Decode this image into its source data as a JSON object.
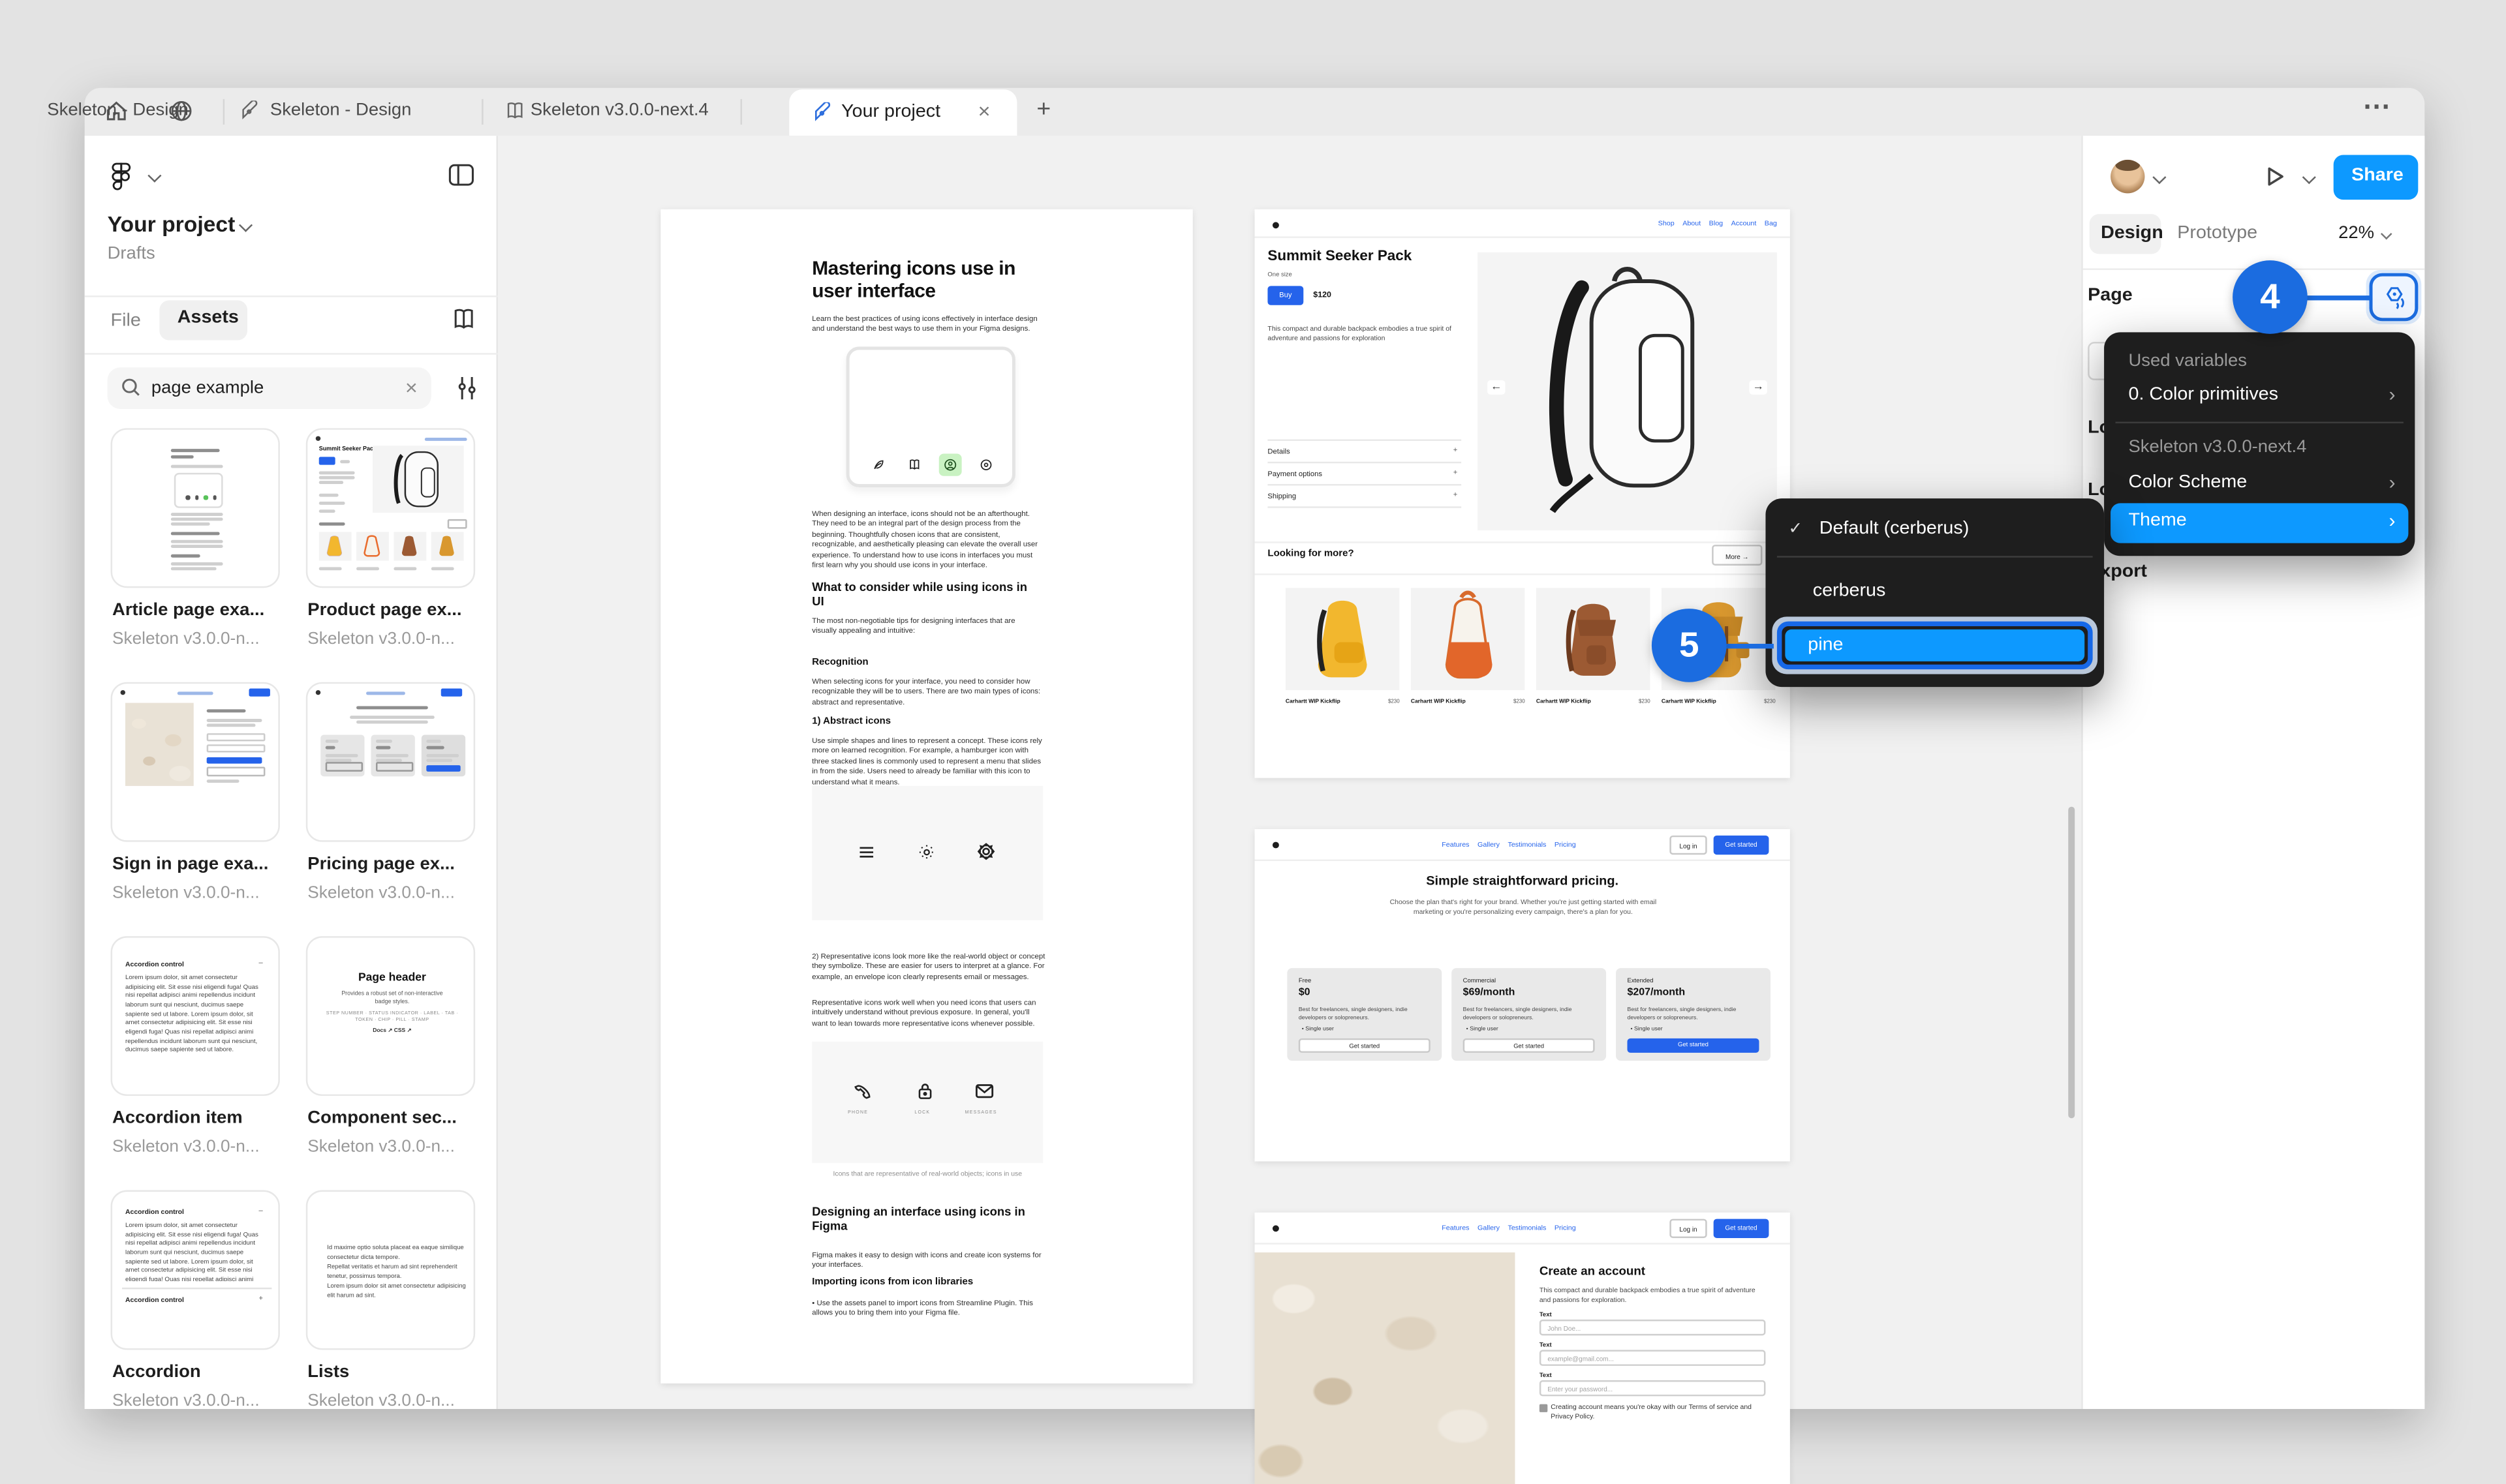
{
  "window": {
    "more_actions_glyph": "⋯",
    "new_tab_glyph": "+",
    "close_glyph": "×"
  },
  "tabs": {
    "tab1": {
      "label": "Skeleton - Design"
    },
    "tab2": {
      "label": "Skeleton v3.0.0-next.4"
    },
    "tab3": {
      "label": "Your project"
    }
  },
  "sidebar": {
    "project_title": "Your project",
    "project_subtitle": "Drafts",
    "tab_file": "File",
    "tab_assets": "Assets",
    "search": {
      "value": "page example",
      "clear_glyph": "×"
    },
    "assets": {
      "items": [
        {
          "title": "Article page exa...",
          "library": "Skeleton v3.0.0-n..."
        },
        {
          "title": "Product page ex...",
          "library": "Skeleton v3.0.0-n..."
        },
        {
          "title": "Sign in page exa...",
          "library": "Skeleton v3.0.0-n..."
        },
        {
          "title": "Pricing page ex...",
          "library": "Skeleton v3.0.0-n..."
        },
        {
          "title": "Accordion item",
          "library": "Skeleton v3.0.0-n..."
        },
        {
          "title": "Component sec...",
          "library": "Skeleton v3.0.0-n..."
        },
        {
          "title": "Accordion",
          "library": "Skeleton v3.0.0-n..."
        },
        {
          "title": "Lists",
          "library": "Skeleton v3.0.0-n..."
        }
      ],
      "thumbs": {
        "accordion_title": "Accordion control",
        "accordion_body": "Lorem ipsum dolor, sit amet consectetur adipisicing elit. Sit esse nisi eligendi fuga! Quas nisi repellat adipisci animi repellendus incidunt laborum sunt qui nesciunt, ducimus saepe sapiente sed ut labore. Lorem ipsum dolor, sit amet consectetur adipisicing elit. Sit esse nisi eligendi fuga! Quas nisi repellat adipisci animi repellendus incidunt laborum sunt qui nesciunt, ducimus saepe sapiente sed ut labore.",
        "accordion_plus": "+",
        "accordion_minus": "–",
        "component_title": "Page header",
        "component_sub": "Provides a robust set of non-interactive badge styles.",
        "component_badges": "STEP NUMBER · STATUS INDICATOR · LABEL · TAB · TOKEN · CHIP · PILL · STAMP",
        "component_links": "Docs ↗    CSS ↗",
        "product_title": "Summit Seeker Pack",
        "lists_li1": "Id maxime optio soluta placeat ea eaque similique consectetur dicta tempore.",
        "lists_li2": "Repellat veritatis et harum ad sint reprehenderit tenetur, possimus tempora.",
        "lists_li3": "Lorem ipsum dolor sit amet consectetur adipisicing elit harum ad sint."
      }
    }
  },
  "canvas": {
    "article": {
      "title": "Mastering icons use in user interface",
      "intro": "Learn the best practices of using icons effectively in interface design and understand the best ways to use them in your Figma designs.",
      "p1": "When designing an interface, icons should not be an afterthought. They need to be an integral part of the design process from the beginning. Thoughtfully chosen icons that are consistent, recognizable, and aesthetically pleasing can elevate the overall user experience. To understand how to use icons in interfaces you must first learn why you should use icons in your interface.",
      "h2_consider": "What to consider while using icons in UI",
      "consider_sub": "The most non-negotiable tips for designing interfaces that are visually appealing and intuitive:",
      "h3_recognition": "Recognition",
      "recognition_p": "When selecting icons for your interface, you need to consider how recognizable they will be to users. There are two main types of icons: abstract and representative.",
      "h3_abstract": "1) Abstract icons",
      "abstract_p": "Use simple shapes and lines to represent a concept. These icons rely more on learned recognition. For example, a hamburger icon with three stacked lines is commonly used to represent a menu that slides in from the side. Users need to already be familiar with this icon to understand what it means.",
      "representative_p1": "2) Representative icons look more like the real-world object or concept they symbolize. These are easier for users to interpret at a glance. For example, an envelope icon clearly represents email or messages.",
      "representative_p2": "Representative icons work well when you need icons that users can intuitively understand without previous exposure. In general, you'll want to lean towards more representative icons whenever possible.",
      "icon_label_phone": "PHONE",
      "icon_label_lock": "LOCK",
      "icon_label_messages": "MESSAGES",
      "caption": "Icons that are representative of real-world objects; icons in use",
      "h2_designing": "Designing an interface using icons in Figma",
      "designing_p": "Figma makes it easy to design with icons and create icon systems for your interfaces.",
      "h3_importing": "Importing icons from icon libraries",
      "importing_li": "•  Use the assets panel to import icons from Streamline Plugin. This allows you to bring them into your Figma file."
    },
    "product": {
      "nav": [
        "Shop",
        "About",
        "Blog",
        "Account",
        "Bag"
      ],
      "title": "Summit Seeker Pack",
      "size_label": "One size",
      "buy_label": "Buy",
      "price": "$120",
      "description": "This compact and durable backpack embodies a true spirit of adventure and passions for exploration",
      "accordion1": "Details",
      "accordion2": "Payment options",
      "accordion3": "Shipping",
      "accordion_plus": "+",
      "more_heading": "Looking for more?",
      "more_button": "More  →",
      "prev_glyph": "←",
      "next_glyph": "→",
      "items": [
        {
          "name": "Carhartt WIP Kickflip",
          "price": "$230"
        },
        {
          "name": "Carhartt WIP Kickflip",
          "price": "$230"
        },
        {
          "name": "Carhartt WIP Kickflip",
          "price": "$230"
        },
        {
          "name": "Carhartt WIP Kickflip",
          "price": "$230"
        }
      ]
    },
    "pricing": {
      "nav": [
        "Features",
        "Gallery",
        "Testimonials",
        "Pricing"
      ],
      "login_label": "Log in",
      "cta_label": "Get started",
      "title": "Simple straightforward pricing.",
      "subtitle": "Choose the plan that's right for your brand. Whether you're just getting started with email marketing or you're personalizing every campaign, there's a plan for you.",
      "plans": [
        {
          "tier": "Free",
          "price": "$0",
          "desc": "Best for freelancers, single designers, indie developers or solopreneurs.",
          "feature": "•  Single user",
          "cta": "Get started"
        },
        {
          "tier": "Commercial",
          "price": "$69/month",
          "desc": "Best for freelancers, single designers, indie developers or solopreneurs.",
          "feature": "•  Single user",
          "cta": "Get started"
        },
        {
          "tier": "Extended",
          "price": "$207/month",
          "desc": "Best for freelancers, single designers, indie developers or solopreneurs.",
          "feature": "•  Single user",
          "cta": "Get started"
        }
      ]
    },
    "signup": {
      "nav": [
        "Features",
        "Gallery",
        "Testimonials",
        "Pricing"
      ],
      "login_label": "Log in",
      "cta_label": "Get started",
      "title": "Create an account",
      "description": "This compact and durable backpack embodies a true spirit of adventure and passions for exploration.",
      "field1_label": "Text",
      "field1_placeholder": "John Doe...",
      "field2_label": "Text",
      "field2_placeholder": "example@gmail.com...",
      "field3_label": "Text",
      "field3_placeholder": "Enter your password...",
      "terms": "Creating account means you're okay with our Terms of service and Privacy Policy."
    }
  },
  "right_panel": {
    "share_label": "Share",
    "tab_design": "Design",
    "tab_prototype": "Prototype",
    "zoom_level": "22%",
    "section_page": "Page",
    "section_local_variables": "Local variables",
    "section_local_styles": "Local styles",
    "section_export": "Export"
  },
  "variables_menu": {
    "header_used": "Used variables",
    "item_color_primitives": "0. Color primitives",
    "header_library": "Skeleton v3.0.0-next.4",
    "item_color_scheme": "Color Scheme",
    "item_theme": "Theme",
    "chevron_glyph": "›"
  },
  "theme_menu": {
    "check_glyph": "✓",
    "item_default": "Default (cerberus)",
    "item_cerberus": "cerberus",
    "item_pine": "pine"
  },
  "annotations": {
    "step4": "4",
    "step5": "5"
  },
  "colors": {
    "accent_blue": "#0d99ff",
    "annotation_blue": "#1b6ce0",
    "link_blue": "#2563eb",
    "menu_bg": "#1e1e1e",
    "highlight_green": "#c9f2c2"
  }
}
